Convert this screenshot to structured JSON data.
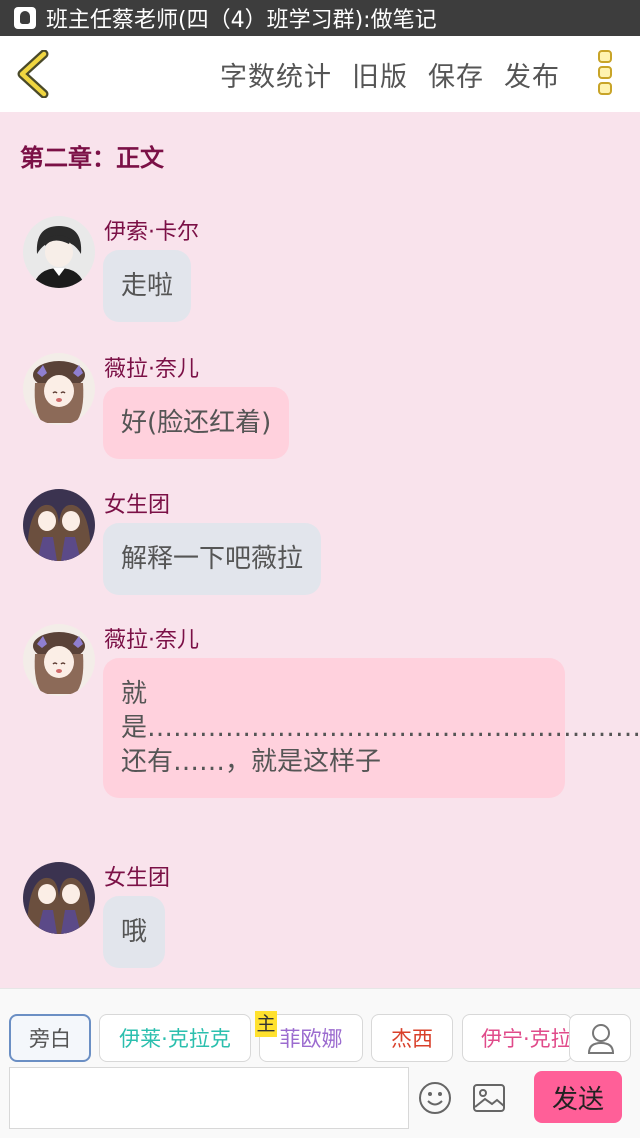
{
  "status_bar": {
    "title": "班主任蔡老师(四（4）班学习群):做笔记",
    "app_icon": "qq-icon"
  },
  "toolbar": {
    "back_icon": "chevron-left-icon",
    "word_count": "字数统计",
    "old_version": "旧版",
    "save": "保存",
    "publish": "发布",
    "more_icon": "more-vertical-icon",
    "accent_color": "#e0c030"
  },
  "chapter": {
    "title": "第二章：正文"
  },
  "messages": [
    {
      "speaker": "伊索·卡尔",
      "text": "走啦",
      "style": "grey",
      "avatar": "boy-avatar"
    },
    {
      "speaker": "薇拉·奈儿",
      "text": "好(脸还红着)",
      "style": "pink",
      "avatar": "girl-avatar"
    },
    {
      "speaker": "女生团",
      "text": "解释一下吧薇拉",
      "style": "grey",
      "avatar": "twins-avatar"
    },
    {
      "speaker": "薇拉·奈儿",
      "text": "就是…………………………………………………………………………………………………………………………………………………………还有……，就是这样子",
      "style": "pink",
      "avatar": "girl-avatar"
    },
    {
      "speaker": "女生团",
      "text": "哦",
      "style": "grey",
      "avatar": "twins-avatar"
    }
  ],
  "composer": {
    "chips": [
      {
        "label": "旁白",
        "color": "#555555"
      },
      {
        "label": "伊莱·克拉克",
        "color": "#2bbfae"
      },
      {
        "label": "菲欧娜",
        "color": "#9b6bcf"
      },
      {
        "label": "杰西",
        "color": "#d9402a"
      },
      {
        "label": "伊宁·克拉",
        "color": "#e04b8a"
      }
    ],
    "main_badge": "主",
    "input_value": "",
    "input_placeholder": "",
    "send_label": "发送",
    "send_color": "#ff5f98",
    "person_icon": "person-icon",
    "emoji_icon": "emoji-icon",
    "image_icon": "image-icon"
  }
}
